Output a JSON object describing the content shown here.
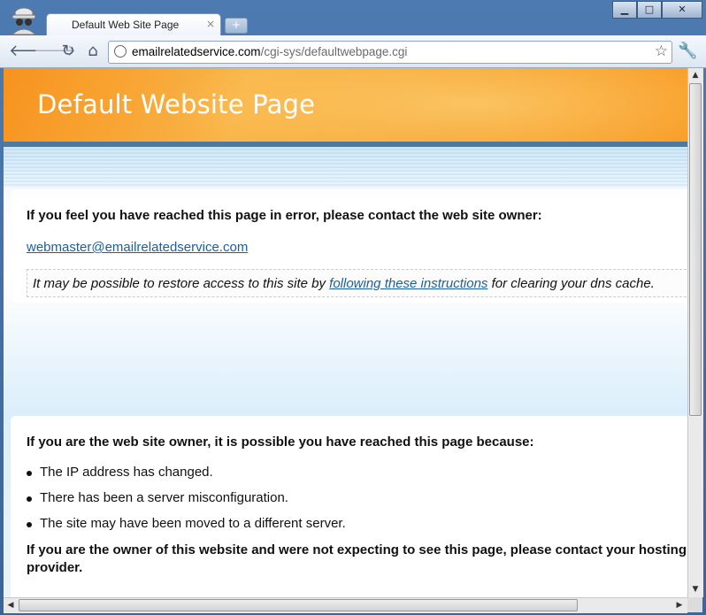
{
  "browser": {
    "tab_title": "Default Web Site Page",
    "tab_close": "×",
    "new_tab": "+",
    "window_buttons": {
      "minimize": "▁",
      "maximize": "□",
      "close": "✕"
    },
    "url_host": "emailrelatedservice.com",
    "url_path": "/cgi-sys/defaultwebpage.cgi",
    "icons": {
      "back": "back-arrow-icon",
      "forward": "forward-arrow-icon",
      "reload": "reload-icon",
      "home": "home-icon",
      "bookmark": "star-icon",
      "menu": "wrench-icon",
      "incognito": "incognito-icon"
    }
  },
  "page": {
    "banner_title": "Default Website Page",
    "colors": {
      "banner": "#f7931e",
      "link": "#1a5f9e",
      "bar": "#4d7aa2"
    },
    "error_panel": {
      "heading": "If you feel you have reached this page in error, please contact the web site owner:",
      "email": "webmaster@emailrelatedservice.com",
      "notice_before": "It may be possible to restore access to this site by ",
      "notice_link": "following these instructions",
      "notice_after": " for clearing your dns cache."
    },
    "owner_panel": {
      "heading": "If you are the web site owner, it is possible you have reached this page because:",
      "reasons": [
        "The IP address has changed.",
        "There has been a server misconfiguration.",
        "The site may have been moved to a different server."
      ],
      "footer": "If you are the owner of this website and were not expecting to see this page, please contact your hosting provider."
    }
  }
}
